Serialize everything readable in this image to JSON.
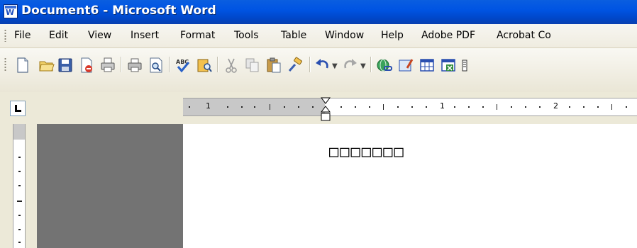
{
  "window": {
    "title": "Document6 - Microsoft Word"
  },
  "menu": {
    "items": [
      "File",
      "Edit",
      "View",
      "Insert",
      "Format",
      "Tools",
      "Table",
      "Window",
      "Help",
      "Adobe PDF",
      "Acrobat Co"
    ]
  },
  "toolbar": {
    "buttons": [
      "new-document",
      "open",
      "save",
      "permission",
      "print",
      "print-preview",
      "spelling-grammar",
      "research",
      "cut",
      "copy",
      "paste",
      "format-painter",
      "undo",
      "redo",
      "hyperlink",
      "tables-borders",
      "insert-table",
      "insert-excel-worksheet",
      "columns"
    ]
  },
  "ruler": {
    "labels": [
      "1",
      "1",
      "2"
    ]
  },
  "document": {
    "text": "□□□□□□□"
  }
}
